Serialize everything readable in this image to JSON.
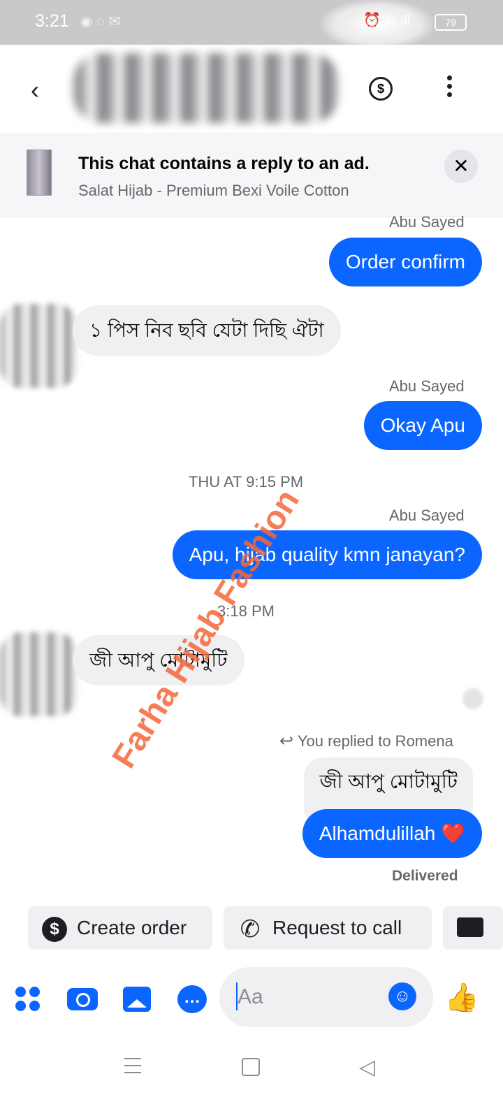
{
  "status_bar": {
    "time": "3:21",
    "battery": "79"
  },
  "header": {
    "back_glyph": "‹",
    "coin_glyph": "$"
  },
  "ad_banner": {
    "title": "This chat contains a reply to an ad.",
    "subtitle": "Salat Hijab - Premium Bexi Voile Cotton",
    "close_glyph": "✕"
  },
  "messages": [
    {
      "sender": "Abu Sayed",
      "text": "Order confirm",
      "direction": "out"
    },
    {
      "text": "১ পিস নিব ছবি যেটা দিছি ঐটা",
      "direction": "in"
    },
    {
      "sender": "Abu Sayed",
      "text": "Okay Apu",
      "direction": "out"
    },
    {
      "timestamp": "THU AT 9:15 PM"
    },
    {
      "sender": "Abu Sayed",
      "text": "Apu, hijab quality kmn janayan?",
      "direction": "out"
    },
    {
      "timestamp": "3:18 PM"
    },
    {
      "text": "জী আপু মোটামুটি",
      "direction": "in"
    }
  ],
  "reply": {
    "note": "You replied to Romena",
    "quoted_text": "জী আপু মোটামুটি",
    "text": "Alhamdulillah ❤️",
    "status": "Delivered"
  },
  "watermark": "Farha Hijab Fashion",
  "quick_actions": [
    {
      "label": "Create order",
      "icon": "dollar-icon",
      "glyph": "$"
    },
    {
      "label": "Request to call",
      "icon": "phone-plus-icon",
      "glyph": "✆"
    }
  ],
  "composer": {
    "placeholder": "Aa",
    "like_glyph": "👍",
    "emoji_glyph": "☺",
    "chat_glyph": "…"
  },
  "colors": {
    "accent": "#0a66ff",
    "watermark": "#f4683a",
    "incoming_bubble": "#f0f0f2"
  }
}
